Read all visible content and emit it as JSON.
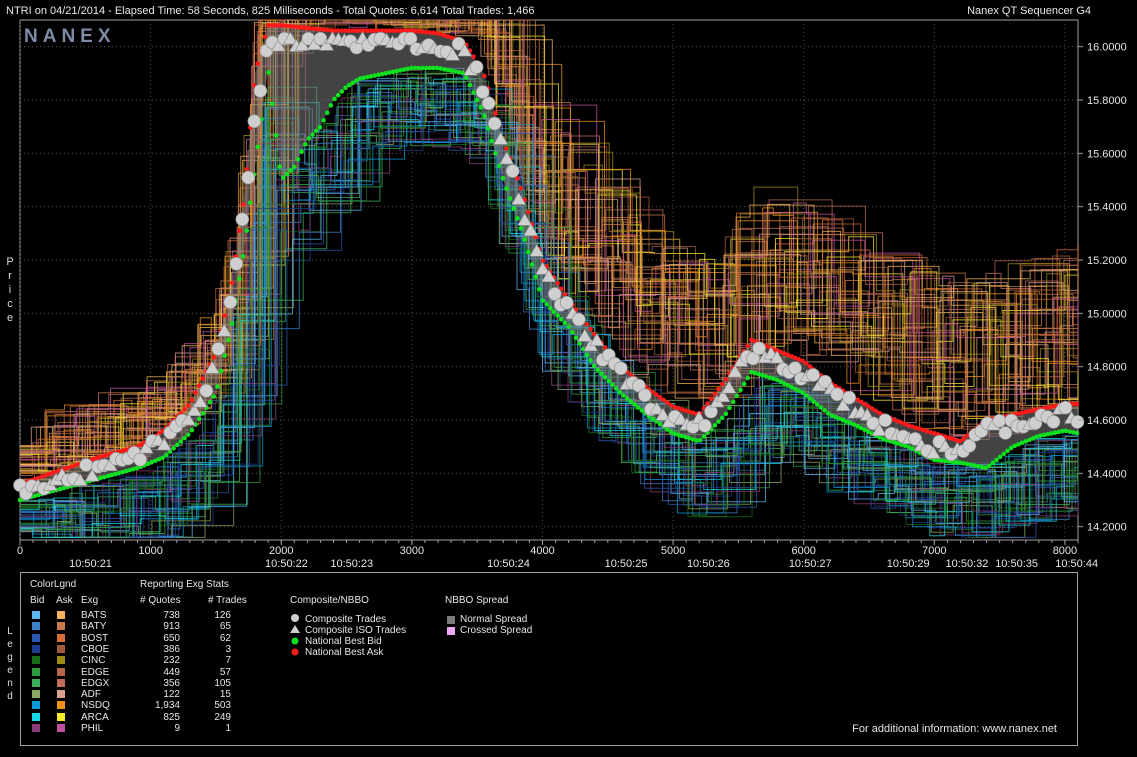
{
  "header": {
    "left": "NTRI on 04/21/2014  -  Elapsed Time: 58 Seconds, 825 Milliseconds  -  Total Quotes: 6,614  Total Trades: 1,466",
    "right": "Nanex QT Sequencer G4"
  },
  "brand": "NANEX",
  "y_axis_label": "Price",
  "legend_side_label": "Legend",
  "chart_data": {
    "type": "line",
    "title": "NTRI on 04/21/2014",
    "ylabel": "Price",
    "ylim": [
      14.15,
      16.1
    ],
    "xlim": [
      0,
      8100
    ],
    "yticks": [
      "16.0000",
      "15.8000",
      "15.6000",
      "15.4000",
      "15.2000",
      "15.0000",
      "14.8000",
      "14.6000",
      "14.4000",
      "14.2000"
    ],
    "ytick_values": [
      16.0,
      15.8,
      15.6,
      15.4,
      15.2,
      15.0,
      14.8,
      14.6,
      14.4,
      14.2
    ],
    "xticks": [
      "0",
      "1000",
      "2000",
      "3000",
      "4000",
      "5000",
      "6000",
      "7000",
      "8000"
    ],
    "xtick_values": [
      0,
      1000,
      2000,
      3000,
      4000,
      5000,
      6000,
      7000,
      8000
    ],
    "time_labels": [
      "10:50:21",
      "10:50:22",
      "10:50:23",
      "10:50:24",
      "10:50:25",
      "10:50:26",
      "10:50:27",
      "10:50:29",
      "10:50:32",
      "10:50:35",
      "10:50:44"
    ],
    "time_label_x": [
      540,
      2040,
      2540,
      3740,
      4640,
      5270,
      6050,
      6800,
      7250,
      7630,
      8090
    ],
    "grid": true,
    "trade_path": {
      "x": [
        0,
        300,
        600,
        900,
        1100,
        1300,
        1500,
        1620,
        1720,
        1800,
        1900,
        2000,
        2200,
        2400,
        2600,
        2800,
        3000,
        3200,
        3400,
        3550,
        3700,
        3850,
        4000,
        4200,
        4400,
        4600,
        4800,
        5000,
        5200,
        5400,
        5600,
        5800,
        6000,
        6200,
        6400,
        6600,
        6800,
        7000,
        7200,
        7400,
        7600,
        7800,
        8000,
        8100
      ],
      "y": [
        14.33,
        14.38,
        14.42,
        14.47,
        14.52,
        14.62,
        14.8,
        15.05,
        15.4,
        15.75,
        16.0,
        16.02,
        16.02,
        16.02,
        16.02,
        16.02,
        16.02,
        16.01,
        15.98,
        15.85,
        15.6,
        15.4,
        15.15,
        15.0,
        14.88,
        14.77,
        14.68,
        14.6,
        14.58,
        14.7,
        14.85,
        14.82,
        14.78,
        14.7,
        14.64,
        14.58,
        14.54,
        14.5,
        14.48,
        14.56,
        14.58,
        14.6,
        14.62,
        14.62
      ]
    },
    "nbb_path": {
      "x": [
        0,
        300,
        600,
        900,
        1100,
        1300,
        1500,
        1620,
        1720,
        1800,
        1900,
        2000,
        2100,
        2200,
        2300,
        2400,
        2500,
        2600,
        2800,
        3000,
        3200,
        3400,
        3550,
        3700,
        3850,
        4000,
        4200,
        4400,
        4600,
        4800,
        5000,
        5200,
        5400,
        5600,
        5800,
        6000,
        6200,
        6400,
        6600,
        6800,
        7000,
        7200,
        7400,
        7600,
        7800,
        8000,
        8100
      ],
      "y": [
        14.3,
        14.34,
        14.38,
        14.42,
        14.46,
        14.55,
        14.7,
        14.95,
        15.25,
        15.55,
        15.92,
        15.5,
        15.55,
        15.65,
        15.7,
        15.8,
        15.85,
        15.88,
        15.9,
        15.92,
        15.92,
        15.9,
        15.75,
        15.5,
        15.3,
        15.05,
        14.95,
        14.8,
        14.7,
        14.62,
        14.55,
        14.52,
        14.62,
        14.78,
        14.75,
        14.7,
        14.62,
        14.58,
        14.53,
        14.5,
        14.45,
        14.44,
        14.42,
        14.5,
        14.54,
        14.56,
        14.55
      ]
    },
    "nbo_path": {
      "x": [
        0,
        300,
        600,
        900,
        1100,
        1300,
        1500,
        1620,
        1720,
        1800,
        1900,
        2000,
        2200,
        2400,
        2600,
        2800,
        3000,
        3200,
        3400,
        3550,
        3700,
        3850,
        4000,
        4200,
        4400,
        4600,
        4800,
        5000,
        5200,
        5400,
        5600,
        5800,
        6000,
        6200,
        6400,
        6600,
        6800,
        7000,
        7200,
        7400,
        7600,
        7800,
        8000,
        8100
      ],
      "y": [
        14.36,
        14.41,
        14.46,
        14.5,
        14.56,
        14.66,
        14.85,
        15.1,
        15.45,
        15.9,
        16.08,
        16.08,
        16.07,
        16.06,
        16.06,
        16.06,
        16.06,
        16.05,
        16.02,
        15.9,
        15.65,
        15.45,
        15.2,
        15.05,
        14.92,
        14.8,
        14.72,
        14.65,
        14.62,
        14.75,
        14.9,
        14.86,
        14.82,
        14.74,
        14.68,
        14.62,
        14.58,
        14.55,
        14.52,
        14.6,
        14.62,
        14.64,
        14.66,
        14.66
      ]
    }
  },
  "legend": {
    "title": "ColorLgnd",
    "col_bid": "Bid",
    "col_ask": "Ask",
    "col_exg": "Exg",
    "stats_title": "Reporting Exg Stats",
    "col_quotes": "# Quotes",
    "col_trades": "# Trades",
    "exchanges": [
      {
        "name": "BATS",
        "quotes": "738",
        "trades": "126",
        "bid_color": "#5fb6f0",
        "ask_color": "#f3b45a"
      },
      {
        "name": "BATY",
        "quotes": "913",
        "trades": "65",
        "bid_color": "#3d7fc8",
        "ask_color": "#c77a4a"
      },
      {
        "name": "BOST",
        "quotes": "650",
        "trades": "62",
        "bid_color": "#2a58b0",
        "ask_color": "#d86c3a"
      },
      {
        "name": "CBOE",
        "quotes": "386",
        "trades": "3",
        "bid_color": "#1e3c8c",
        "ask_color": "#a05a3c"
      },
      {
        "name": "CINC",
        "quotes": "232",
        "trades": "7",
        "bid_color": "#1a6e1a",
        "ask_color": "#a08c14"
      },
      {
        "name": "EDGE",
        "quotes": "449",
        "trades": "57",
        "bid_color": "#2e9a3e",
        "ask_color": "#b8664a"
      },
      {
        "name": "EDGX",
        "quotes": "356",
        "trades": "105",
        "bid_color": "#3cb05a",
        "ask_color": "#c0705a"
      },
      {
        "name": "ADF",
        "quotes": "122",
        "trades": "15",
        "bid_color": "#8aa860",
        "ask_color": "#d8a090"
      },
      {
        "name": "NSDQ",
        "quotes": "1,934",
        "trades": "503",
        "bid_color": "#0a9ad8",
        "ask_color": "#f09018"
      },
      {
        "name": "ARCA",
        "quotes": "825",
        "trades": "249",
        "bid_color": "#18d8e8",
        "ask_color": "#f8e830"
      },
      {
        "name": "PHIL",
        "quotes": "9",
        "trades": "1",
        "bid_color": "#8c3c78",
        "ask_color": "#c050a0"
      }
    ],
    "composite_title": "Composite/NBBO",
    "composite_items": [
      "Composite Trades",
      "Composite ISO Trades",
      "National Best Bid",
      "National Best Ask"
    ],
    "spread_title": "NBBO Spread",
    "spread_items": [
      "Normal Spread",
      "Crossed Spread"
    ],
    "spread_colors": [
      "#7a7a7a",
      "#f0a8f0"
    ],
    "footer": "For additional information: www.nanex.net"
  },
  "colors": {
    "trade_marker": "#cfcfcf",
    "nbb": "#10e020",
    "nbo": "#ff1a1a",
    "frame": "#a0a0a0",
    "grid": "#505050",
    "spread": "#7a7a7a"
  }
}
